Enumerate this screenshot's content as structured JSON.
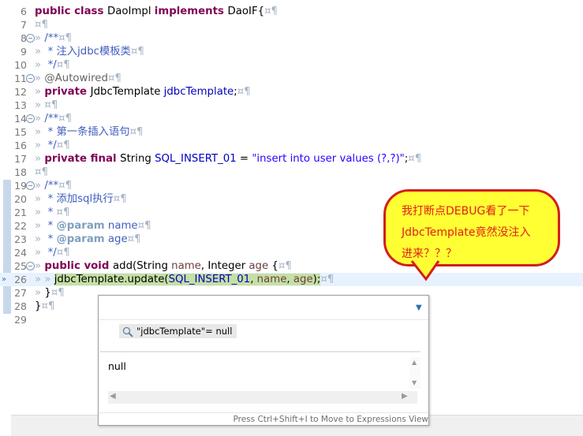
{
  "editor": {
    "lines": [
      {
        "num": "6",
        "parts": [
          [
            "kw",
            "public class "
          ],
          [
            "",
            "DaoImpl "
          ],
          [
            "kw",
            "implements "
          ],
          [
            "",
            "DaoIF{"
          ],
          [
            "ws",
            "¤¶"
          ]
        ]
      },
      {
        "num": "7",
        "parts": [
          [
            "ws",
            "¤¶"
          ]
        ]
      },
      {
        "num": "8",
        "fold": "−",
        "parts": [
          [
            "ws",
            "» "
          ],
          [
            "cm",
            "/**"
          ],
          [
            "ws",
            "¤¶"
          ]
        ]
      },
      {
        "num": "9",
        "parts": [
          [
            "ws",
            "» "
          ],
          [
            "cm",
            " * 注入jdbc模板类"
          ],
          [
            "ws",
            "¤¶"
          ]
        ]
      },
      {
        "num": "10",
        "parts": [
          [
            "ws",
            "» "
          ],
          [
            "cm",
            " */"
          ],
          [
            "ws",
            "¤¶"
          ]
        ]
      },
      {
        "num": "11",
        "fold": "−",
        "parts": [
          [
            "ws",
            "» "
          ],
          [
            "ann",
            "@Autowired"
          ],
          [
            "ws",
            "¤¶"
          ]
        ]
      },
      {
        "num": "12",
        "parts": [
          [
            "ws",
            "» "
          ],
          [
            "kw",
            "private "
          ],
          [
            "",
            "JdbcTemplate "
          ],
          [
            "fld",
            "jdbcTemplate"
          ],
          [
            "",
            ";"
          ],
          [
            "ws",
            "¤¶"
          ]
        ]
      },
      {
        "num": "13",
        "parts": [
          [
            "ws",
            "» ¤¶"
          ]
        ]
      },
      {
        "num": "14",
        "fold": "−",
        "parts": [
          [
            "ws",
            "» "
          ],
          [
            "cm",
            "/**"
          ],
          [
            "ws",
            "¤¶"
          ]
        ]
      },
      {
        "num": "15",
        "parts": [
          [
            "ws",
            "» "
          ],
          [
            "cm",
            " * 第一条插入语句"
          ],
          [
            "ws",
            "¤¶"
          ]
        ]
      },
      {
        "num": "16",
        "parts": [
          [
            "ws",
            "» "
          ],
          [
            "cm",
            " */"
          ],
          [
            "ws",
            "¤¶"
          ]
        ]
      },
      {
        "num": "17",
        "parts": [
          [
            "ws",
            "» "
          ],
          [
            "kw",
            "private final "
          ],
          [
            "",
            "String "
          ],
          [
            "fld",
            "SQL_INSERT_01"
          ],
          [
            "",
            " = "
          ],
          [
            "str",
            "\"insert into user values (?,?)\""
          ],
          [
            "",
            ";"
          ],
          [
            "ws",
            "¤¶"
          ]
        ]
      },
      {
        "num": "18",
        "parts": [
          [
            "ws",
            "¤¶"
          ]
        ]
      },
      {
        "num": "19",
        "fold": "−",
        "parts": [
          [
            "ws",
            "» "
          ],
          [
            "cm",
            "/**"
          ],
          [
            "ws",
            "¤¶"
          ]
        ]
      },
      {
        "num": "20",
        "parts": [
          [
            "ws",
            "» "
          ],
          [
            "cm",
            " * 添加sql执行"
          ],
          [
            "ws",
            "¤¶"
          ]
        ]
      },
      {
        "num": "21",
        "parts": [
          [
            "ws",
            "» "
          ],
          [
            "cm",
            " * "
          ],
          [
            "ws",
            "¤¶"
          ]
        ]
      },
      {
        "num": "22",
        "parts": [
          [
            "ws",
            "» "
          ],
          [
            "cm",
            " * "
          ],
          [
            "tag",
            "@param"
          ],
          [
            "cm",
            " name"
          ],
          [
            "ws",
            "¤¶"
          ]
        ]
      },
      {
        "num": "23",
        "parts": [
          [
            "ws",
            "» "
          ],
          [
            "cm",
            " * "
          ],
          [
            "tag",
            "@param"
          ],
          [
            "cm",
            " age"
          ],
          [
            "ws",
            "¤¶"
          ]
        ]
      },
      {
        "num": "24",
        "parts": [
          [
            "ws",
            "» "
          ],
          [
            "cm",
            " */"
          ],
          [
            "ws",
            "¤¶"
          ]
        ]
      },
      {
        "num": "25",
        "fold": "−",
        "parts": [
          [
            "ws",
            "» "
          ],
          [
            "kw",
            "public void "
          ],
          [
            "",
            "add(String "
          ],
          [
            "loc",
            "name"
          ],
          [
            "",
            ", Integer "
          ],
          [
            "loc",
            "age"
          ],
          [
            "",
            " {"
          ],
          [
            "ws",
            "¤¶"
          ]
        ]
      },
      {
        "num": "26",
        "current": true,
        "parts": [
          [
            "ws",
            "» » "
          ],
          [
            "hl",
            "jdbcTemplate.update("
          ],
          [
            "hlfld",
            "SQL_INSERT_01"
          ],
          [
            "hl",
            ", "
          ],
          [
            "hlloc",
            "name"
          ],
          [
            "hl",
            ", "
          ],
          [
            "hlloc",
            "age"
          ],
          [
            "hl",
            ");"
          ],
          [
            "ws",
            "¤¶"
          ]
        ]
      },
      {
        "num": "27",
        "parts": [
          [
            "ws",
            "» "
          ],
          [
            "",
            "}"
          ],
          [
            "ws",
            "¤¶"
          ]
        ]
      },
      {
        "num": "28",
        "parts": [
          [
            "",
            "}"
          ],
          [
            "ws",
            "¤¶"
          ]
        ]
      },
      {
        "num": "29",
        "parts": []
      }
    ]
  },
  "bubble": {
    "lines": [
      "我打断点DEBUG看了一下",
      "JdbcTemplate竟然没注入",
      "进来？？？"
    ],
    "fill_color": "#ffff33",
    "border_color": "#d21e1e",
    "text_color": "#e0201a"
  },
  "popup": {
    "expression": "\"jdbcTemplate\"= null",
    "search_icon": "magnifier-icon",
    "dropdown_icon": "chevron-down-icon",
    "value": "null",
    "footer": "Press Ctrl+Shift+I to Move to Expressions View"
  }
}
